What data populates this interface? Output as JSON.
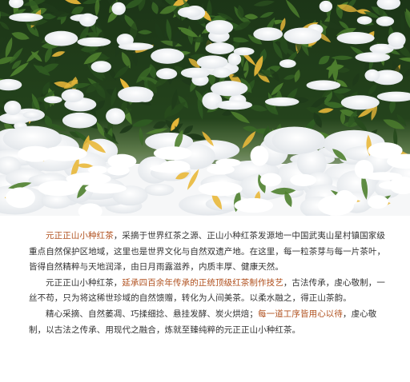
{
  "photo": {
    "subject": "snow-covered-tea-bushes",
    "colors": {
      "leaf_dark": "#1f3a1a",
      "leaf": "#2f5a22",
      "leaf_light": "#4e7f2e",
      "yellow_leaf": "#e9b83a",
      "snow": "#ffffff",
      "snow_shadow": "#e4e8ec"
    }
  },
  "article": {
    "colors": {
      "text": "#333333",
      "highlight": "#b0501e"
    },
    "p1": {
      "hl": "元正正山小种红茶",
      "t1": "，采摘于世界红茶之源、正山小种红茶发源地一中国武夷山星村镇国家级重点自然保护区地域，这里也是世界文化与自然双遗产地。在这里，每一粒茶芽与每一片茶叶，皆得自然精粹与天地润泽，由日月雨露滋养，内质丰厚、健康天然。"
    },
    "p2": {
      "t1": "元正正山小种红茶，",
      "hl": "延承四百余年传承的正统顶级红茶制作技艺",
      "t2": "，古法传承，虔心敬制，一丝不苟，只为将这稀世珍域的自然馈赠，转化为人间美茶。以柔水融之，得正山茶韵。"
    },
    "p3": {
      "t1": "精心采摘、自然萎凋、巧揉细捻、悬挂发酵、炭火烘焙；",
      "hl": "每一道工序皆用心以待",
      "t2": "，虔心敬制，以古法之传承、用现代之融合，炼就至臻纯粹的元正正山小种红茶。"
    }
  }
}
